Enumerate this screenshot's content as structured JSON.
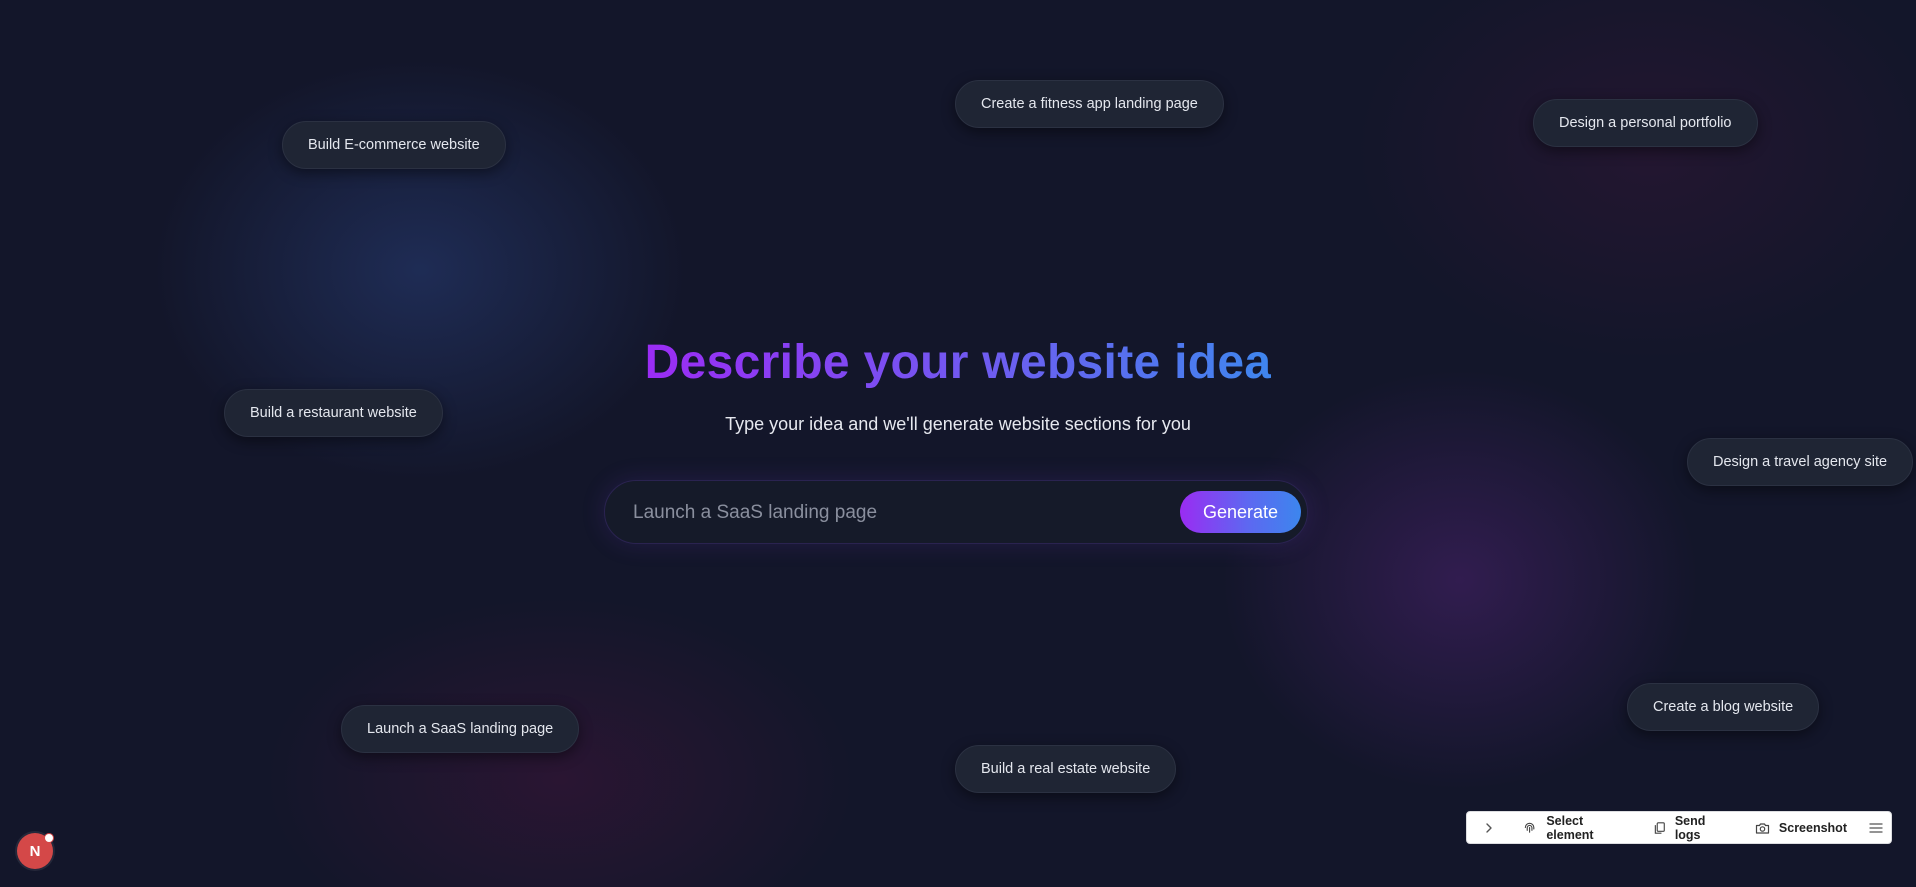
{
  "suggestions": [
    {
      "label": "Build E-commerce website"
    },
    {
      "label": "Create a fitness app landing page"
    },
    {
      "label": "Design a personal portfolio"
    },
    {
      "label": "Build a restaurant website"
    },
    {
      "label": "Design a travel agency site"
    },
    {
      "label": "Launch a SaaS landing page"
    },
    {
      "label": "Build a real estate website"
    },
    {
      "label": "Create a blog website"
    }
  ],
  "hero": {
    "title": "Describe your website idea",
    "subtitle": "Type your idea and we'll generate website sections for you"
  },
  "prompt": {
    "placeholder": "Launch a SaaS landing page",
    "value": "",
    "generate_label": "Generate"
  },
  "devtools": {
    "select_element_label": "Select element",
    "send_logs_label": "Send logs",
    "screenshot_label": "Screenshot"
  },
  "avatar": {
    "initial": "N"
  },
  "colors": {
    "background": "#13162a",
    "gradient_start": "#9b2cf5",
    "gradient_end": "#3f86ee",
    "chip_bg": "#1f2534",
    "avatar": "#d44848"
  }
}
